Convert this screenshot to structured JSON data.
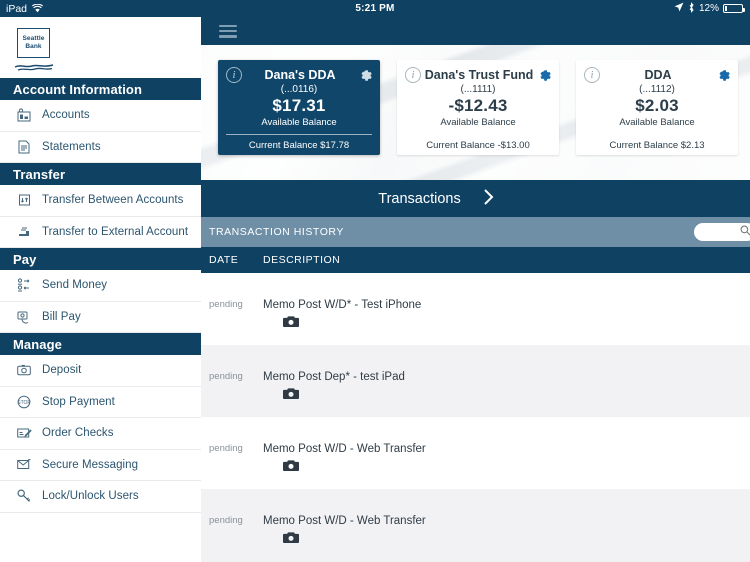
{
  "status_bar": {
    "device": "iPad",
    "wifi_icon": "wifi-icon",
    "time": "5:21 PM",
    "location_icon": "location-arrow-icon",
    "bluetooth_icon": "bluetooth-icon",
    "battery_percent": "12%"
  },
  "brand": {
    "logo_line1": "Seattle",
    "logo_line2": "Bank"
  },
  "sidebar": {
    "sections": [
      {
        "title": "Account Information",
        "items": [
          {
            "label": "Accounts",
            "icon": "accounts-icon"
          },
          {
            "label": "Statements",
            "icon": "document-icon"
          }
        ]
      },
      {
        "title": "Transfer",
        "items": [
          {
            "label": "Transfer Between Accounts",
            "icon": "transfer-icon"
          },
          {
            "label": "Transfer to External Account",
            "icon": "external-transfer-icon"
          }
        ]
      },
      {
        "title": "Pay",
        "items": [
          {
            "label": "Send Money",
            "icon": "send-money-icon"
          },
          {
            "label": "Bill Pay",
            "icon": "bill-pay-icon"
          }
        ]
      },
      {
        "title": "Manage",
        "items": [
          {
            "label": "Deposit",
            "icon": "camera-deposit-icon"
          },
          {
            "label": "Stop Payment",
            "icon": "stop-payment-icon"
          },
          {
            "label": "Order Checks",
            "icon": "order-checks-icon"
          },
          {
            "label": "Secure Messaging",
            "icon": "mail-icon"
          },
          {
            "label": "Lock/Unlock Users",
            "icon": "key-icon"
          }
        ]
      }
    ]
  },
  "main": {
    "menu_icon": "hamburger-menu-icon",
    "accounts": [
      {
        "name": "Dana's DDA",
        "account_number": "(...0116)",
        "available_amount": "$17.31",
        "available_label": "Available Balance",
        "current_balance": "Current Balance $17.78",
        "selected": true,
        "info_icon": "info-icon",
        "gear_icon": "gear-icon"
      },
      {
        "name": "Dana's Trust Fund",
        "account_number": "(...1111)",
        "available_amount": "-$12.43",
        "available_label": "Available Balance",
        "current_balance": "Current Balance -$13.00",
        "selected": false,
        "info_icon": "info-icon",
        "gear_icon": "gear-icon"
      },
      {
        "name": "DDA",
        "account_number": "(...1112)",
        "available_amount": "$2.03",
        "available_label": "Available Balance",
        "current_balance": "Current Balance $2.13",
        "selected": false,
        "info_icon": "info-icon",
        "gear_icon": "gear-icon"
      }
    ],
    "transactions_tab": {
      "label": "Transactions",
      "chevron_icon": "chevron-right-icon"
    },
    "history": {
      "title": "TRANSACTION HISTORY",
      "search_placeholder": "",
      "search_value": "",
      "search_icon": "search-icon"
    },
    "table": {
      "columns": [
        "DATE",
        "DESCRIPTION"
      ],
      "rows": [
        {
          "date": "pending",
          "description": "Memo Post W/D* - Test iPhone",
          "attachment_icon": "camera-icon"
        },
        {
          "date": "pending",
          "description": "Memo Post Dep* - test iPad",
          "attachment_icon": "camera-icon"
        },
        {
          "date": "pending",
          "description": "Memo Post W/D - Web Transfer",
          "attachment_icon": "camera-icon"
        },
        {
          "date": "pending",
          "description": "Memo Post W/D - Web Transfer",
          "attachment_icon": "camera-icon"
        }
      ]
    }
  },
  "colors": {
    "navy": "#0f4163",
    "card_navy": "#104669",
    "steel": "#6f8fa6",
    "link_text": "#2b556f"
  }
}
